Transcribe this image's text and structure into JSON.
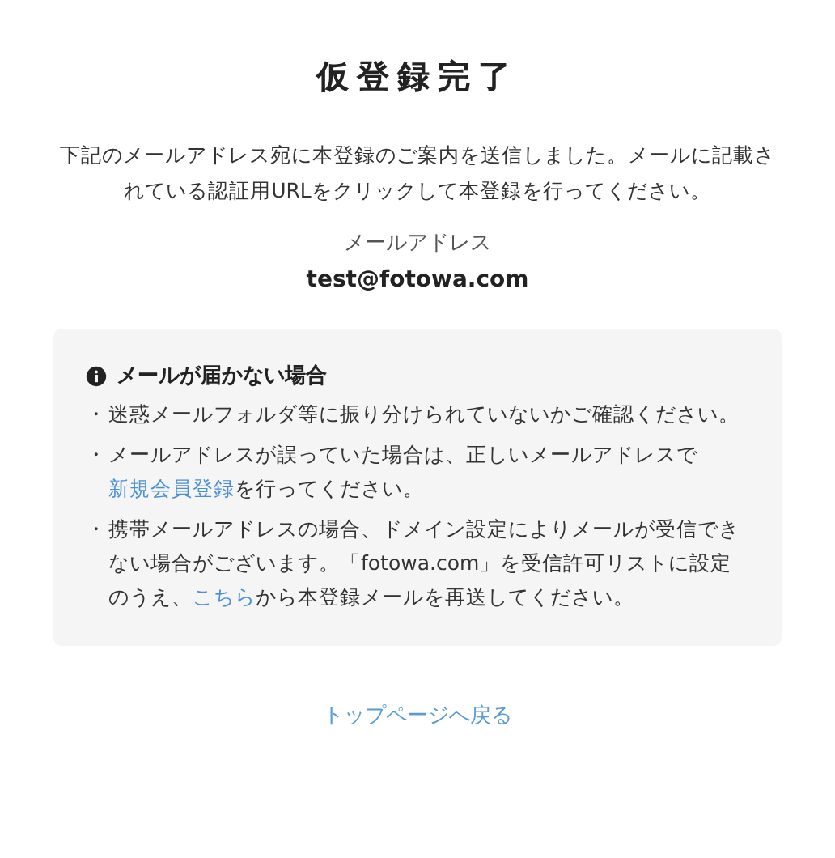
{
  "title": "仮登録完了",
  "message": "下記のメールアドレス宛に本登録のご案内を送信しました。メールに記載されている認証用URLをクリックして本登録を行ってください。",
  "email_label": "メールアドレス",
  "email": "test@fotowa.com",
  "notice": {
    "heading": "メールが届かない場合",
    "items": [
      {
        "bullet": "・",
        "parts": [
          {
            "kind": "text",
            "text": "迷惑メールフォルダ等に振り分けられていないかご確認ください。"
          }
        ]
      },
      {
        "bullet": "・",
        "parts": [
          {
            "kind": "text",
            "text": "メールアドレスが誤っていた場合は、正しいメールアドレスで"
          },
          {
            "kind": "link",
            "text": "新規会員登録"
          },
          {
            "kind": "text",
            "text": "を行ってください。"
          }
        ]
      },
      {
        "bullet": "・",
        "parts": [
          {
            "kind": "text",
            "text": "携帯メールアドレスの場合、ドメイン設定によりメールが受信できない場合がございます。「fotowa.com」を受信許可リストに設定のうえ、"
          },
          {
            "kind": "link",
            "text": "こちら"
          },
          {
            "kind": "text",
            "text": "から本登録メールを再送してください。"
          }
        ]
      }
    ]
  },
  "back_link": "トップページへ戻る"
}
